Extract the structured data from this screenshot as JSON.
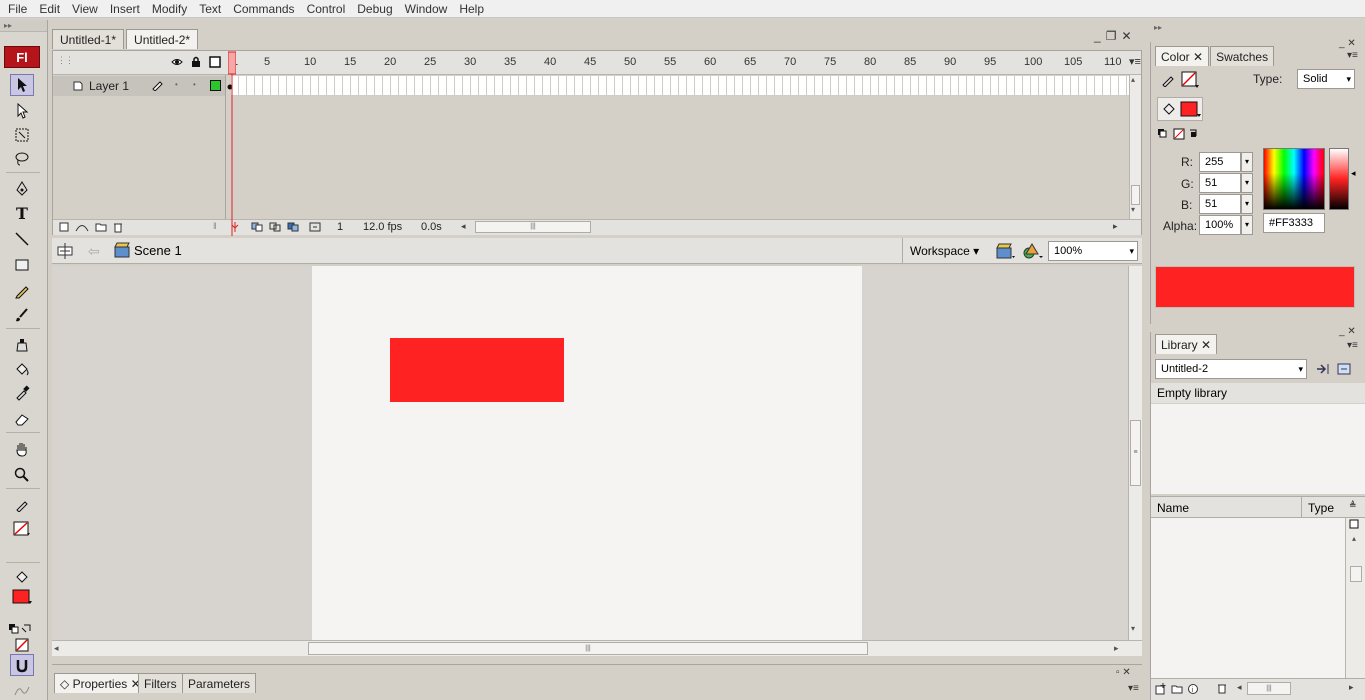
{
  "menu": [
    "File",
    "Edit",
    "View",
    "Insert",
    "Modify",
    "Text",
    "Commands",
    "Control",
    "Debug",
    "Window",
    "Help"
  ],
  "app_logo": "Fl",
  "documents": {
    "tabs": [
      "Untitled-1*",
      "Untitled-2*"
    ],
    "active": 1
  },
  "timeline": {
    "ruler_numbers": [
      "1",
      "5",
      "10",
      "15",
      "20",
      "25",
      "30",
      "35",
      "40",
      "45",
      "50",
      "55",
      "60",
      "65",
      "70",
      "75",
      "80",
      "85",
      "90",
      "95",
      "100",
      "105",
      "110"
    ],
    "layer_name": "Layer 1",
    "current_frame": "1",
    "frame_rate": "12.0 fps",
    "elapsed_time": "0.0s"
  },
  "editbar": {
    "scene": "Scene 1",
    "workspace": "Workspace",
    "zoom": "100%"
  },
  "stage": {
    "background": "#f5f4f2",
    "shape_color": "#ff2222"
  },
  "color_panel": {
    "tabs": [
      "Color",
      "Swatches"
    ],
    "type_label": "Type:",
    "type_value": "Solid",
    "r_label": "R:",
    "r_value": "255",
    "g_label": "G:",
    "g_value": "51",
    "b_label": "B:",
    "b_value": "51",
    "alpha_label": "Alpha:",
    "alpha_value": "100%",
    "hex_value": "#FF3333",
    "preview_color": "#ff2222"
  },
  "library_panel": {
    "tab": "Library",
    "document": "Untitled-2",
    "status": "Empty library",
    "col_name": "Name",
    "col_type": "Type"
  },
  "properties": {
    "tabs": [
      "Properties",
      "Filters",
      "Parameters"
    ]
  }
}
